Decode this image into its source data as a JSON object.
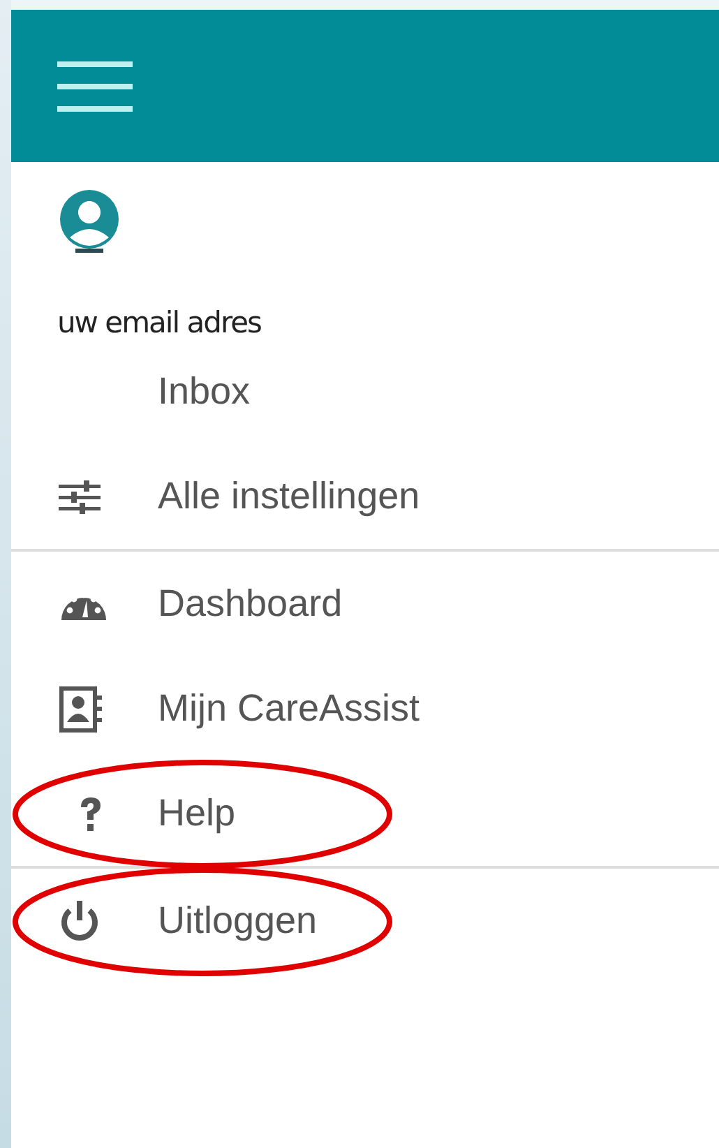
{
  "user": {
    "email": "uw email adres"
  },
  "sections": [
    {
      "items": [
        {
          "kind": "inbox",
          "label": "Inbox",
          "highlighted": false
        },
        {
          "kind": "settings",
          "label": "Alle instellingen",
          "highlighted": false
        }
      ]
    },
    {
      "items": [
        {
          "kind": "dashboard",
          "label": "Dashboard",
          "highlighted": false
        },
        {
          "kind": "profile",
          "label": "Mijn CareAssist",
          "highlighted": false
        },
        {
          "kind": "help",
          "label": "Help",
          "highlighted": true
        }
      ]
    },
    {
      "items": [
        {
          "kind": "logout",
          "label": "Uitloggen",
          "highlighted": true
        }
      ]
    }
  ]
}
